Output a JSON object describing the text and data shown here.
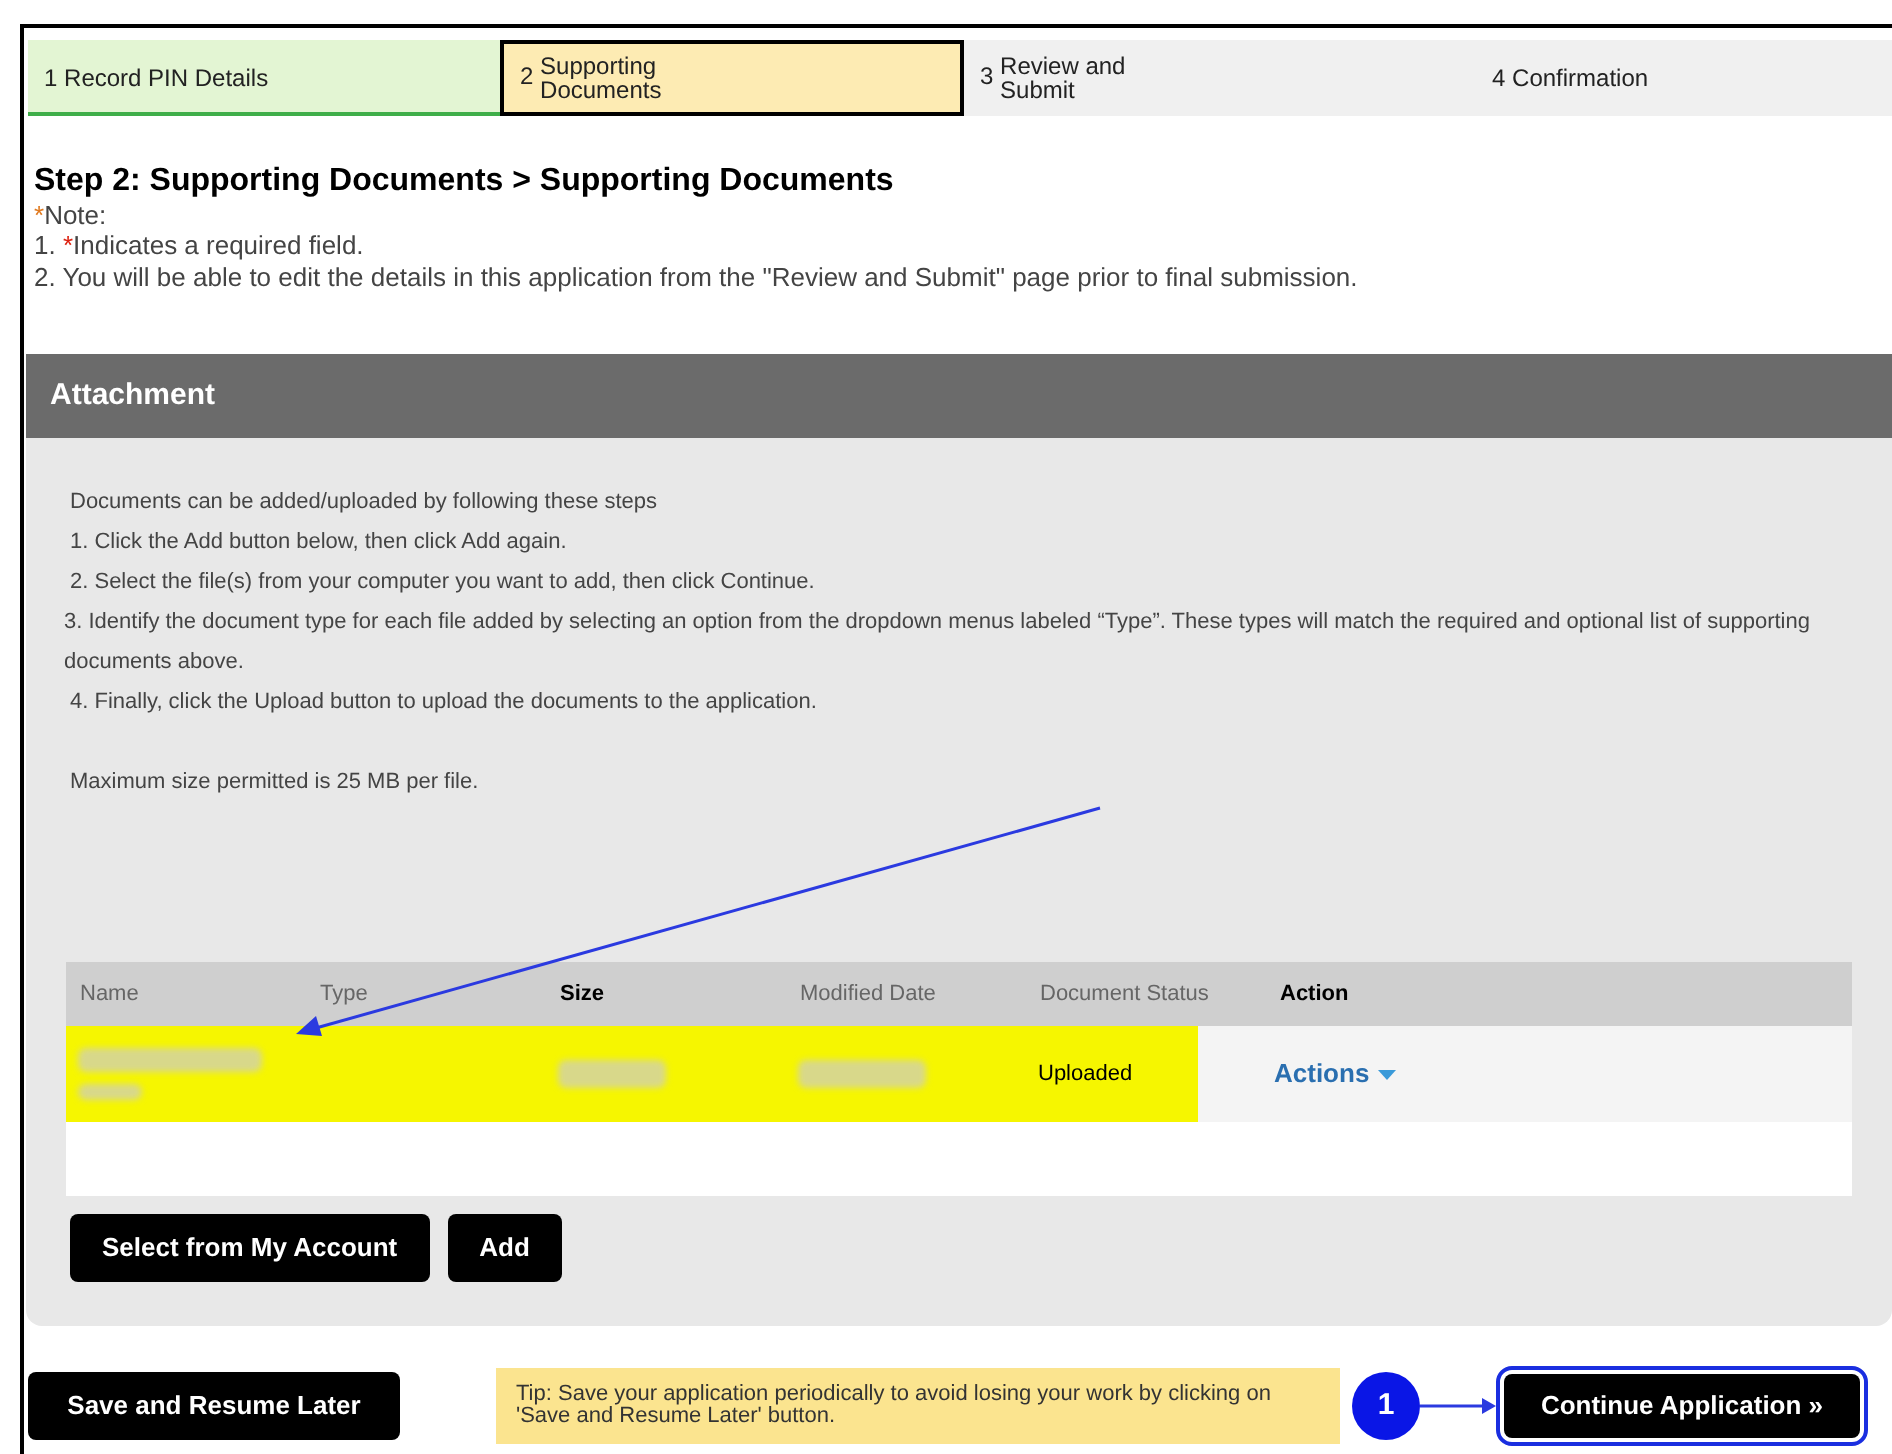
{
  "steps": [
    {
      "number": "1",
      "label": "Record PIN Details",
      "completed": true,
      "selected": false
    },
    {
      "number": "2",
      "label": "Supporting Documents",
      "completed": false,
      "selected": true
    },
    {
      "number": "3",
      "label": "Review and Submit",
      "completed": false,
      "selected": false
    },
    {
      "number": "4",
      "label": "Confirmation",
      "completed": false,
      "selected": false
    }
  ],
  "heading": "Step 2: Supporting Documents > Supporting Documents",
  "note_label": "Note:",
  "notes": [
    {
      "prefix": "1. ",
      "required_mark": "*",
      "text": "Indicates a required field."
    },
    {
      "text": "2. You will be able to edit the details in this application from the \"Review and Submit\" page prior to final submission."
    }
  ],
  "panel": {
    "title": "Attachment",
    "instructions": [
      "Documents can be added/uploaded by following these steps",
      "1. Click the Add button below, then click Add again.",
      "2. Select the file(s) from your computer you want to add, then click Continue.",
      "3. Identify the document type for each file added by selecting an option from the dropdown menus labeled “Type”. These types will match the required and optional list of supporting documents above.",
      "4. Finally, click the Upload button to upload the documents to the application."
    ],
    "max_size": "Maximum size permitted is 25 MB per file.",
    "table": {
      "columns": [
        {
          "label": "Name",
          "bold": false
        },
        {
          "label": "Type",
          "bold": false
        },
        {
          "label": "Size",
          "bold": true
        },
        {
          "label": "Modified Date",
          "bold": false
        },
        {
          "label": "Document Status",
          "bold": false
        },
        {
          "label": "Action",
          "bold": true
        }
      ],
      "rows": [
        {
          "highlighted": true,
          "status": "Uploaded",
          "action": "Actions"
        }
      ]
    },
    "buttons": [
      "Select from My Account",
      "Add"
    ]
  },
  "footer": {
    "save_button": "Save and Resume Later",
    "tip": "Tip: Save your application periodically to avoid losing your work by clicking on 'Save and Resume Later' button.",
    "callout": "1",
    "continue_button": "Continue Application »"
  }
}
